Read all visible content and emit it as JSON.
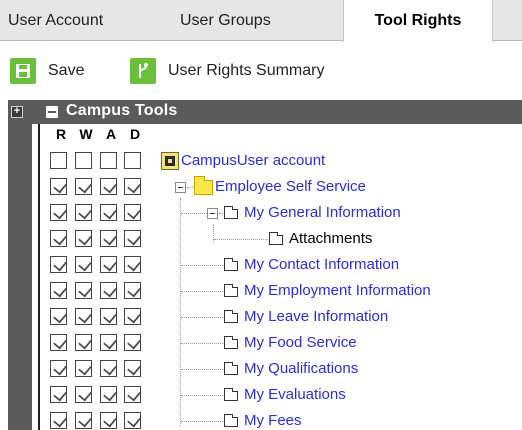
{
  "tabs": [
    {
      "label": "User Account",
      "active": false
    },
    {
      "label": "User Groups",
      "active": false
    },
    {
      "label": "Tool Rights",
      "active": true
    }
  ],
  "toolbar": {
    "save_label": "Save",
    "summary_label": "User Rights Summary",
    "accent_color": "#6bbf3a"
  },
  "tree": {
    "title": "Campus Tools",
    "columns": [
      "R",
      "W",
      "A",
      "D"
    ],
    "rows": [
      {
        "label": "CampusUser account",
        "checked": [
          false,
          false,
          false,
          false
        ],
        "icon": "app-icon"
      },
      {
        "label": "Employee Self Service",
        "checked": [
          true,
          true,
          true,
          true
        ],
        "icon": "folder-icon"
      },
      {
        "label": "My General Information",
        "checked": [
          true,
          true,
          true,
          true
        ],
        "icon": "page-icon"
      },
      {
        "label": "Attachments",
        "checked": [
          true,
          true,
          true,
          true
        ],
        "icon": "page-icon"
      },
      {
        "label": "My Contact Information",
        "checked": [
          true,
          true,
          true,
          true
        ],
        "icon": "page-icon"
      },
      {
        "label": "My Employment Information",
        "checked": [
          true,
          true,
          true,
          true
        ],
        "icon": "page-icon"
      },
      {
        "label": "My Leave Information",
        "checked": [
          true,
          true,
          true,
          true
        ],
        "icon": "page-icon"
      },
      {
        "label": "My Food Service",
        "checked": [
          true,
          true,
          true,
          true
        ],
        "icon": "page-icon"
      },
      {
        "label": "My Qualifications",
        "checked": [
          true,
          true,
          true,
          true
        ],
        "icon": "page-icon"
      },
      {
        "label": "My Evaluations",
        "checked": [
          true,
          true,
          true,
          true
        ],
        "icon": "page-icon"
      },
      {
        "label": "My Fees",
        "checked": [
          true,
          true,
          true,
          true
        ],
        "icon": "page-icon"
      }
    ]
  }
}
